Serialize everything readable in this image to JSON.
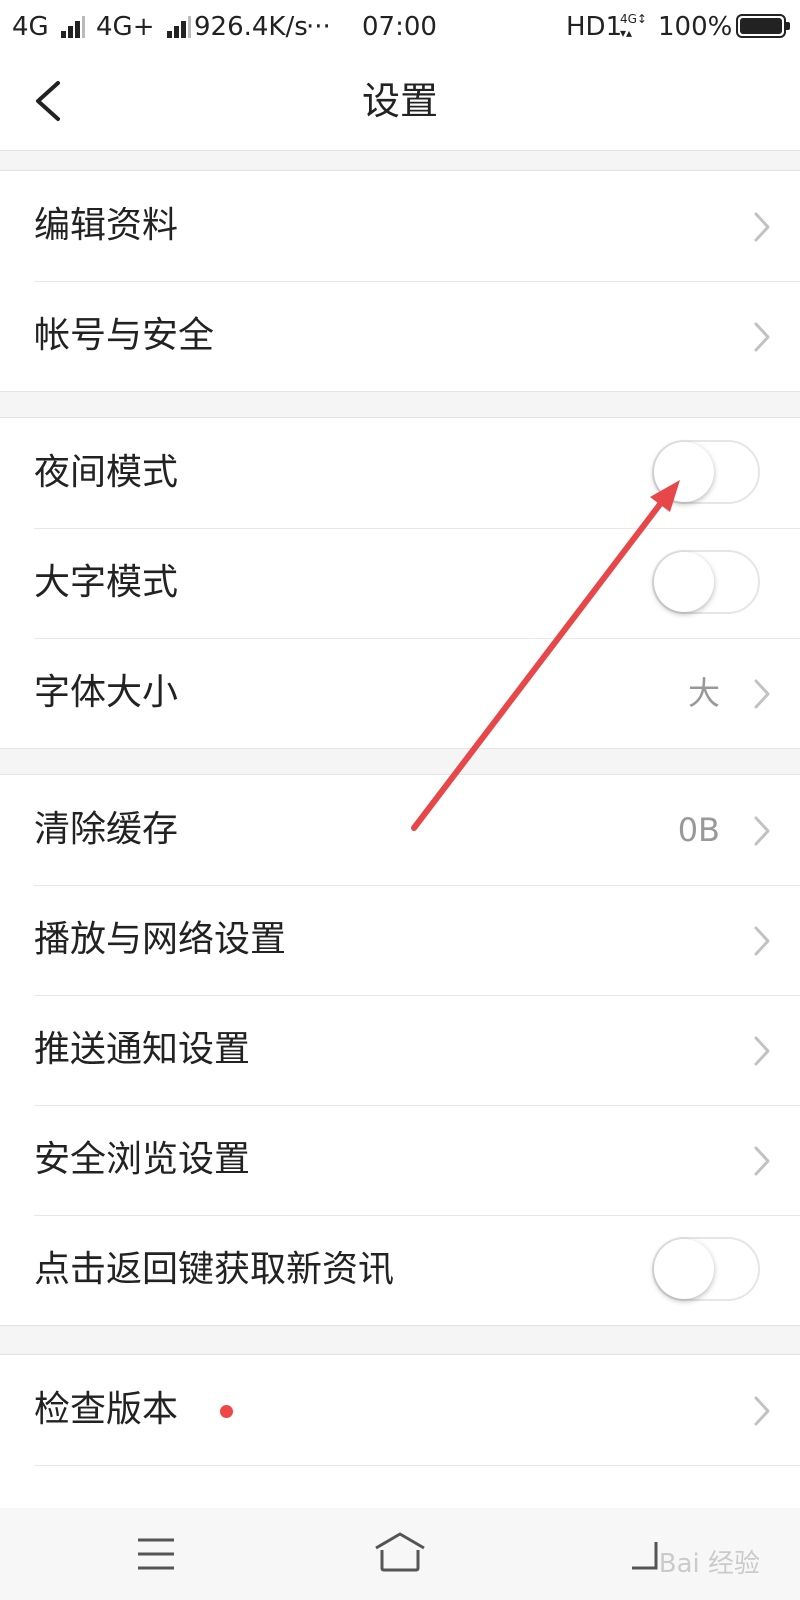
{
  "status_bar": {
    "network1": "4G",
    "network2": "4G+",
    "speed": "926.4K/s",
    "more": "···",
    "time": "07:00",
    "hd": "HD1",
    "battery": "100%"
  },
  "header": {
    "title": "设置"
  },
  "groups": {
    "account": {
      "edit_profile": "编辑资料",
      "account_security": "帐号与安全"
    },
    "display": {
      "night_mode": "夜间模式",
      "large_font_mode": "大字模式",
      "font_size": "字体大小",
      "font_size_value": "大"
    },
    "general": {
      "clear_cache": "清除缓存",
      "cache_size": "0B",
      "playback_network": "播放与网络设置",
      "push_notifications": "推送通知设置",
      "safe_browsing": "安全浏览设置",
      "back_refresh": "点击返回键获取新资讯"
    },
    "about": {
      "check_version": "检查版本"
    }
  },
  "toggles": {
    "night_mode": false,
    "large_font_mode": false,
    "back_refresh": false
  },
  "colors": {
    "annotation_arrow": "#e8474a",
    "update_dot": "#f04646",
    "background": "#f5f5f5"
  }
}
